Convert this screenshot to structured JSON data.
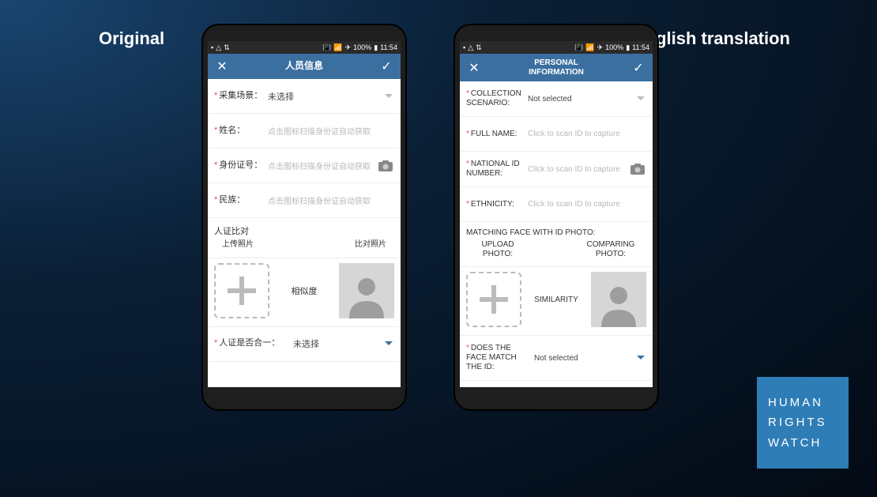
{
  "headings": {
    "left": "Original",
    "right": "English translation"
  },
  "statusbar": {
    "signal": "100%",
    "time": "11:54"
  },
  "original": {
    "title": "人员信息",
    "fields": {
      "scenario_label": "采集场景：",
      "scenario_value": "未选择",
      "fullname_label": "姓名：",
      "fullname_placeholder": "点击图标扫描身份证自动获取",
      "idnum_label": "身份证号：",
      "idnum_placeholder": "点击图标扫描身份证自动获取",
      "ethnicity_label": "民族：",
      "ethnicity_placeholder": "点击图标扫描身份证自动获取"
    },
    "match": {
      "title": "人证比对",
      "upload_label": "上传照片",
      "compare_label": "比对照片",
      "similarity": "相似度"
    },
    "facecheck_label": "人证是否合一：",
    "facecheck_value": "未选择"
  },
  "english": {
    "title_line1": "PERSONAL",
    "title_line2": "INFORMATION",
    "fields": {
      "scenario_label": "COLLECTION SCENARIO:",
      "scenario_value": "Not selected",
      "fullname_label": "FULL NAME:",
      "fullname_placeholder": "Click to scan ID to capture",
      "idnum_label": "NATIONAL ID NUMBER:",
      "idnum_placeholder": "Click to scan ID to capture",
      "ethnicity_label": "ETHNICITY:",
      "ethnicity_placeholder": "Click to scan ID to capture"
    },
    "match": {
      "title": "MATCHING FACE WITH ID PHOTO:",
      "upload_label": "UPLOAD PHOTO:",
      "compare_label": "COMPARING PHOTO:",
      "similarity": "SIMILARITY"
    },
    "facecheck_label": "DOES THE FACE MATCH THE ID:",
    "facecheck_value": "Not selected"
  },
  "logo": {
    "l1": "HUMAN",
    "l2": "RIGHTS",
    "l3": "WATCH"
  }
}
